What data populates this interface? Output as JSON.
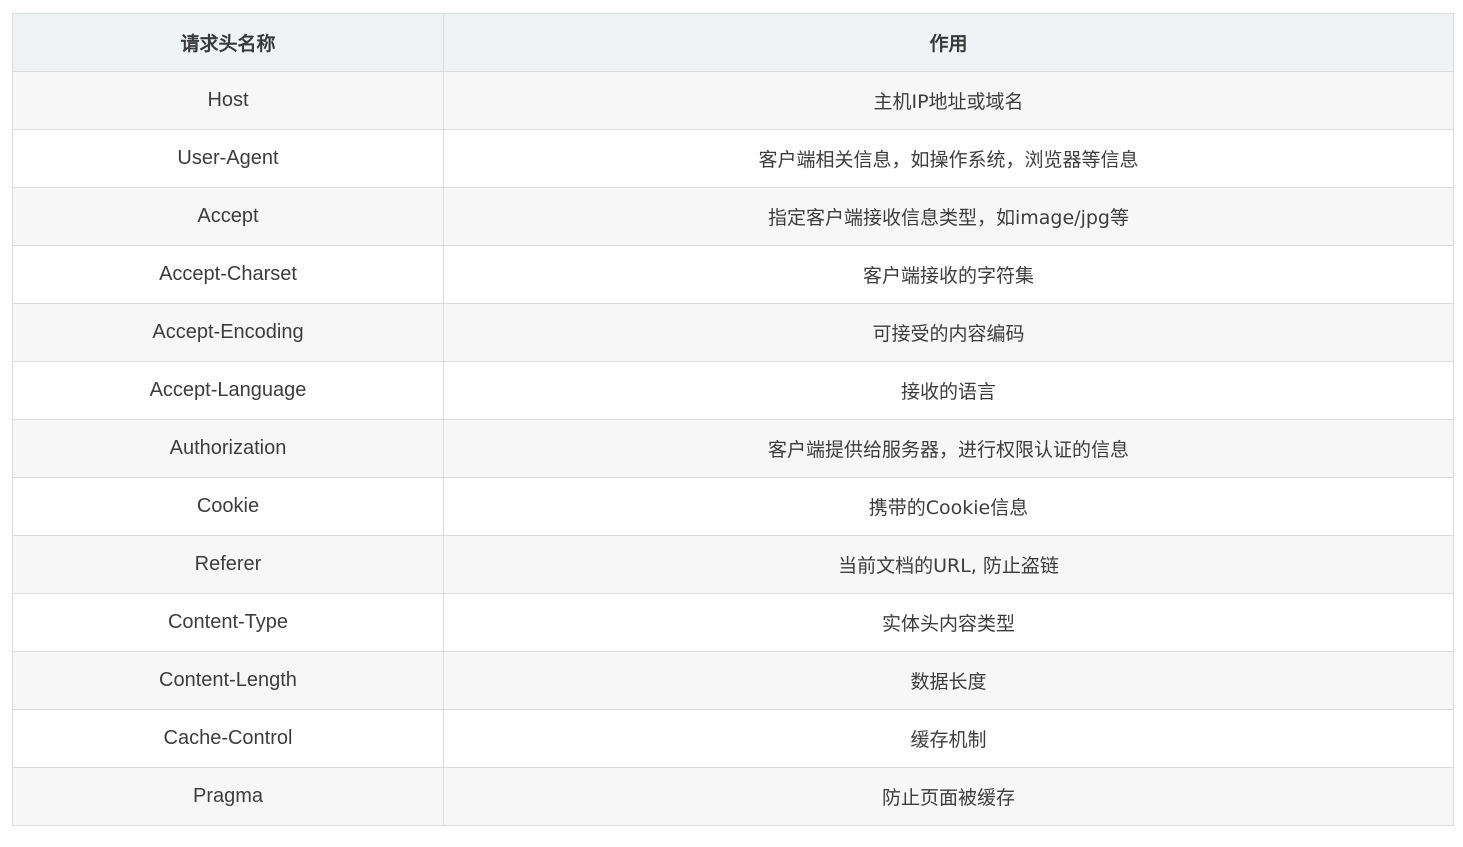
{
  "table": {
    "headers": [
      "请求头名称",
      "作用"
    ],
    "rows": [
      {
        "name": "Host",
        "desc": "主机IP地址或域名"
      },
      {
        "name": "User-Agent",
        "desc": "客户端相关信息，如操作系统，浏览器等信息"
      },
      {
        "name": "Accept",
        "desc": "指定客户端接收信息类型，如image/jpg等"
      },
      {
        "name": "Accept-Charset",
        "desc": "客户端接收的字符集"
      },
      {
        "name": "Accept-Encoding",
        "desc": "可接受的内容编码"
      },
      {
        "name": "Accept-Language",
        "desc": "接收的语言"
      },
      {
        "name": "Authorization",
        "desc": "客户端提供给服务器，进行权限认证的信息"
      },
      {
        "name": "Cookie",
        "desc": "携带的Cookie信息"
      },
      {
        "name": "Referer",
        "desc": "当前文档的URL, 防止盗链"
      },
      {
        "name": "Content-Type",
        "desc": "实体头内容类型"
      },
      {
        "name": "Content-Length",
        "desc": "数据长度"
      },
      {
        "name": "Cache-Control",
        "desc": "缓存机制"
      },
      {
        "name": "Pragma",
        "desc": "防止页面被缓存"
      }
    ]
  },
  "colors": {
    "header_bg": "#eff3f5",
    "row_alt_bg": "#f7f7f7",
    "border": "#dcdcdc",
    "text": "#333333"
  }
}
